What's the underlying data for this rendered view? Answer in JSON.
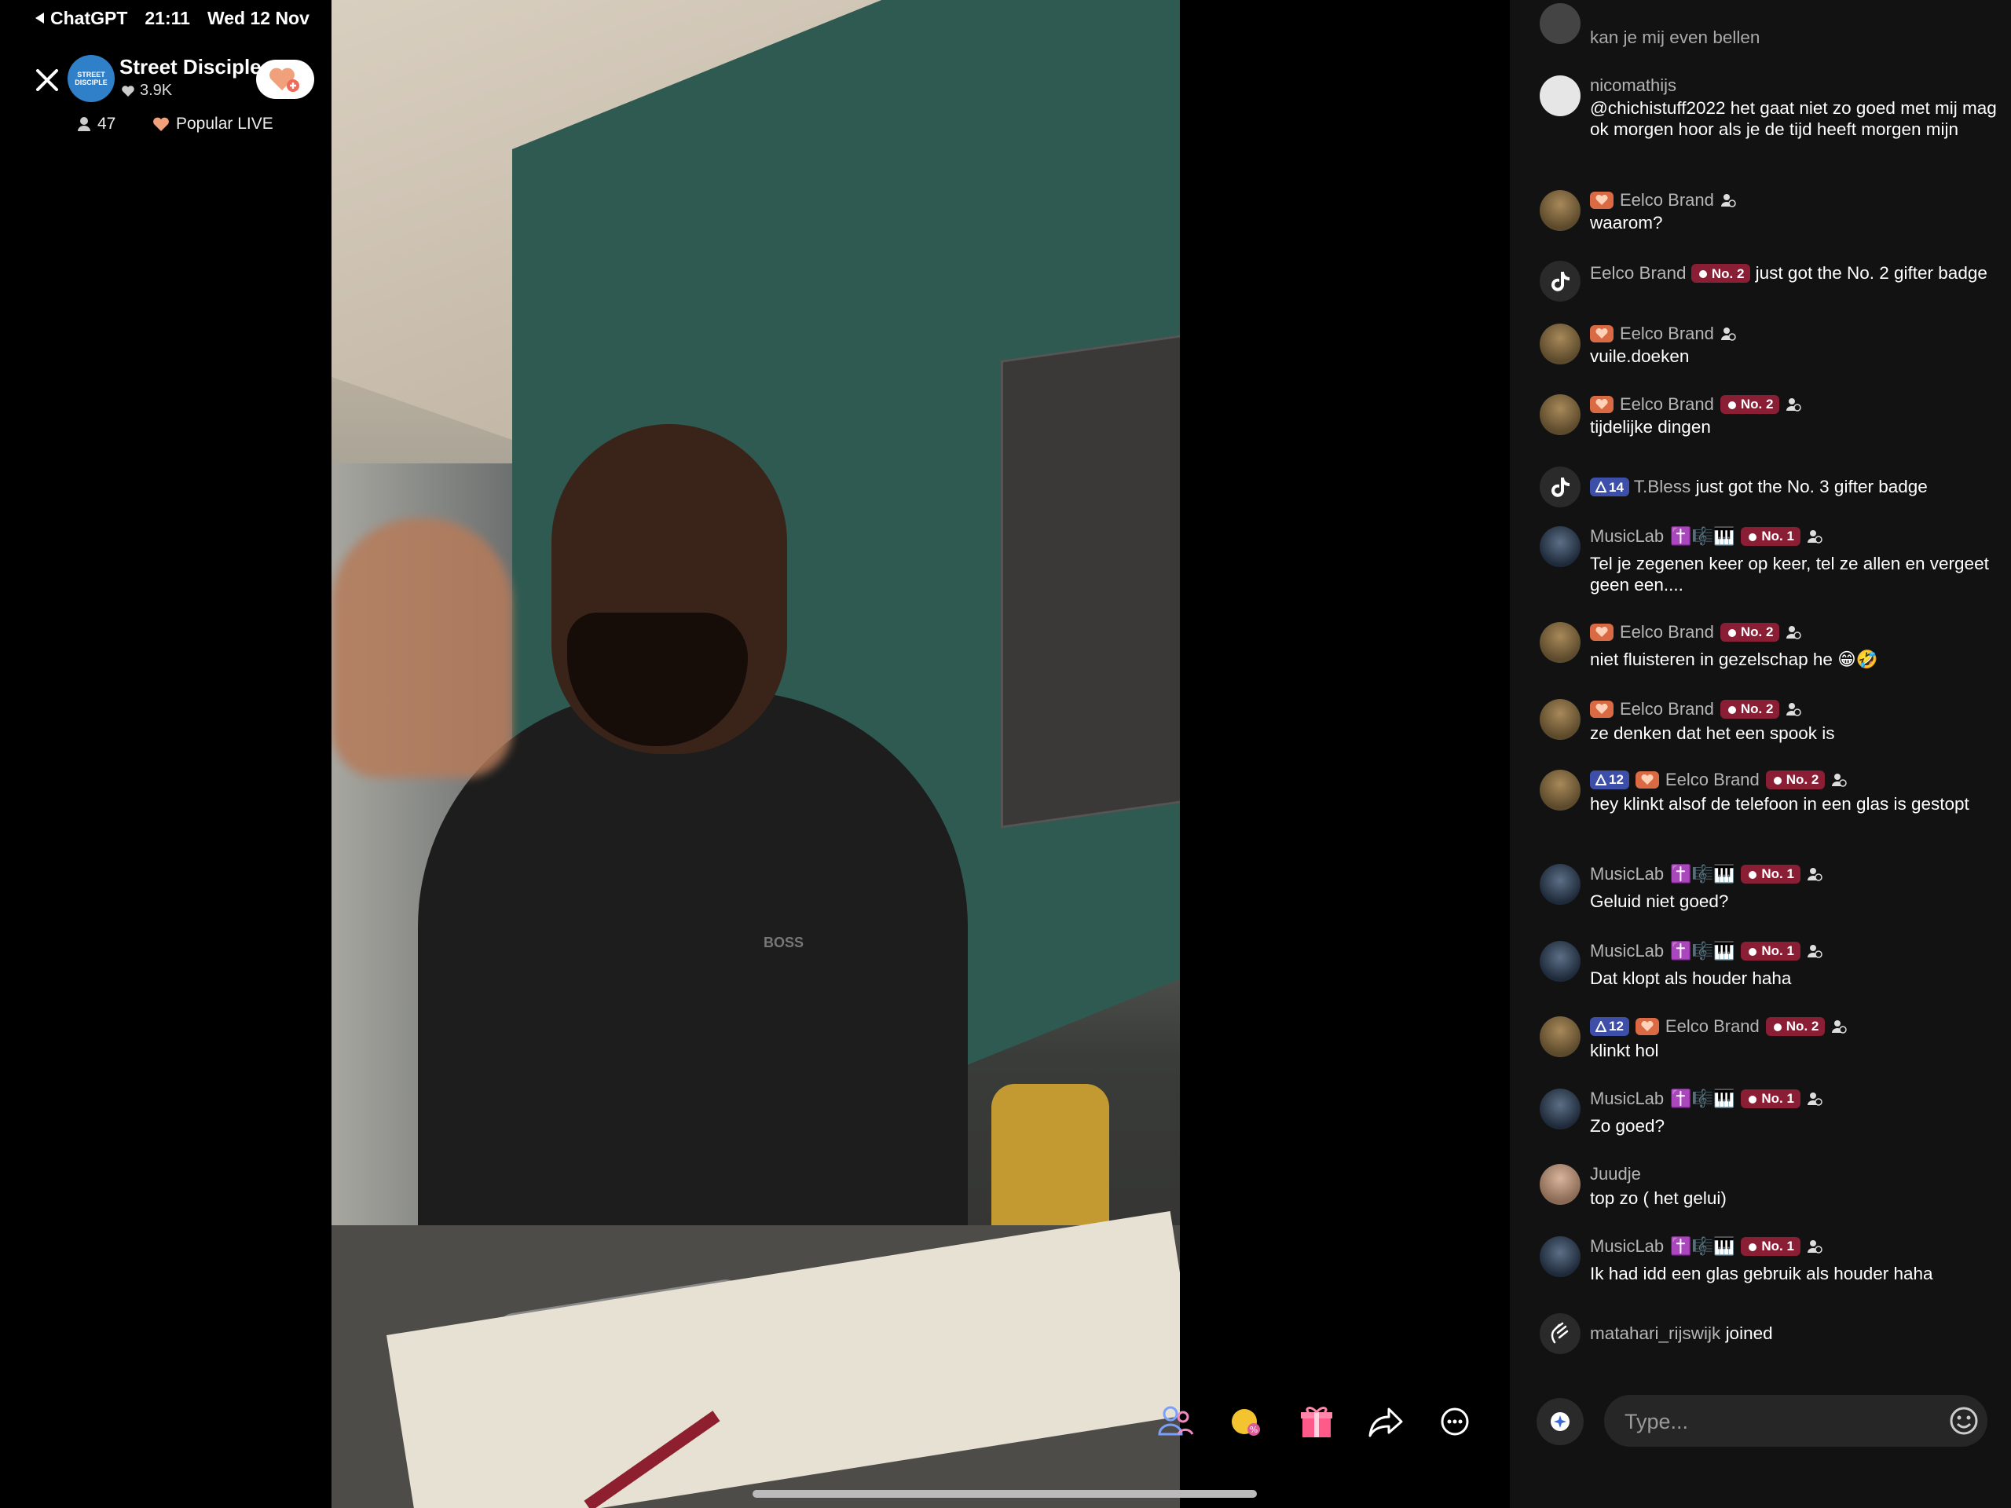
{
  "status_bar": {
    "back_app": "ChatGPT",
    "time": "21:11",
    "date": "Wed 12 Nov"
  },
  "live": {
    "host_name": "Street Disciple",
    "host_logo_text": "STREET DISCIPLE",
    "likes": "3.9K",
    "viewers": "47",
    "popular_label": "Popular LIVE",
    "video_shirt_text": "BOSS"
  },
  "chat": {
    "messages": [
      {
        "type": "user",
        "avatar": "grey",
        "name": "",
        "text": "kan je mij even bellen"
      },
      {
        "type": "user",
        "avatar": "white",
        "name": "nicomathijs",
        "text": "@chichistuff2022 het gaat niet zo goed met mij mag ok morgen hoor als je de tijd heeft morgen mijn"
      },
      {
        "type": "user",
        "avatar": "brown",
        "name": "Eelco Brand",
        "text": "waarom?"
      },
      {
        "type": "system",
        "name": "Eelco Brand",
        "badge": "No. 2",
        "suffix": "just got the No. 2 gifter badge"
      },
      {
        "type": "user",
        "avatar": "brown",
        "name": "Eelco Brand",
        "text": "vuile.doeken"
      },
      {
        "type": "user",
        "avatar": "brown",
        "name": "Eelco Brand",
        "badge": "No. 2",
        "text": "tijdelijke dingen"
      },
      {
        "type": "system",
        "level": "14",
        "name": "T.Bless",
        "suffix": "just got the No. 3 gifter badge"
      },
      {
        "type": "user",
        "avatar": "music",
        "name": "MusicLab",
        "emoji": "✝️🎼🎹",
        "badge": "No. 1",
        "text": "Tel je zegenen keer op keer, tel ze allen en vergeet geen een...."
      },
      {
        "type": "user",
        "avatar": "brown",
        "name": "Eelco Brand",
        "badge": "No. 2",
        "text": "niet fluisteren in gezelschap he 😁🤣"
      },
      {
        "type": "user",
        "avatar": "brown",
        "name": "Eelco Brand",
        "badge": "No. 2",
        "text": "ze denken dat het een spook is"
      },
      {
        "type": "user",
        "avatar": "brown",
        "name": "Eelco Brand",
        "level": "12",
        "badge": "No. 2",
        "text": "hey klinkt alsof de telefoon in een glas is gestopt"
      },
      {
        "type": "user",
        "avatar": "music",
        "name": "MusicLab",
        "emoji": "✝️🎼🎹",
        "badge": "No. 1",
        "text": "Geluid niet goed?"
      },
      {
        "type": "user",
        "avatar": "music",
        "name": "MusicLab",
        "emoji": "✝️🎼🎹",
        "badge": "No. 1",
        "text": "Dat klopt als houder haha"
      },
      {
        "type": "user",
        "avatar": "brown",
        "name": "Eelco Brand",
        "level": "12",
        "badge": "No. 2",
        "text": "klinkt hol"
      },
      {
        "type": "user",
        "avatar": "music",
        "name": "MusicLab",
        "emoji": "✝️🎼🎹",
        "badge": "No. 1",
        "text": "Zo goed?"
      },
      {
        "type": "user",
        "avatar": "juud",
        "name": "Juudje",
        "text": "top zo ( het gelui)"
      },
      {
        "type": "user",
        "avatar": "music",
        "name": "MusicLab",
        "emoji": "✝️🎼🎹",
        "badge": "No. 1",
        "text": "Ik had idd een glas gebruik als houder haha"
      },
      {
        "type": "join",
        "name": "matahari_rijswijk",
        "suffix": "joined"
      }
    ],
    "input_placeholder": "Type..."
  }
}
